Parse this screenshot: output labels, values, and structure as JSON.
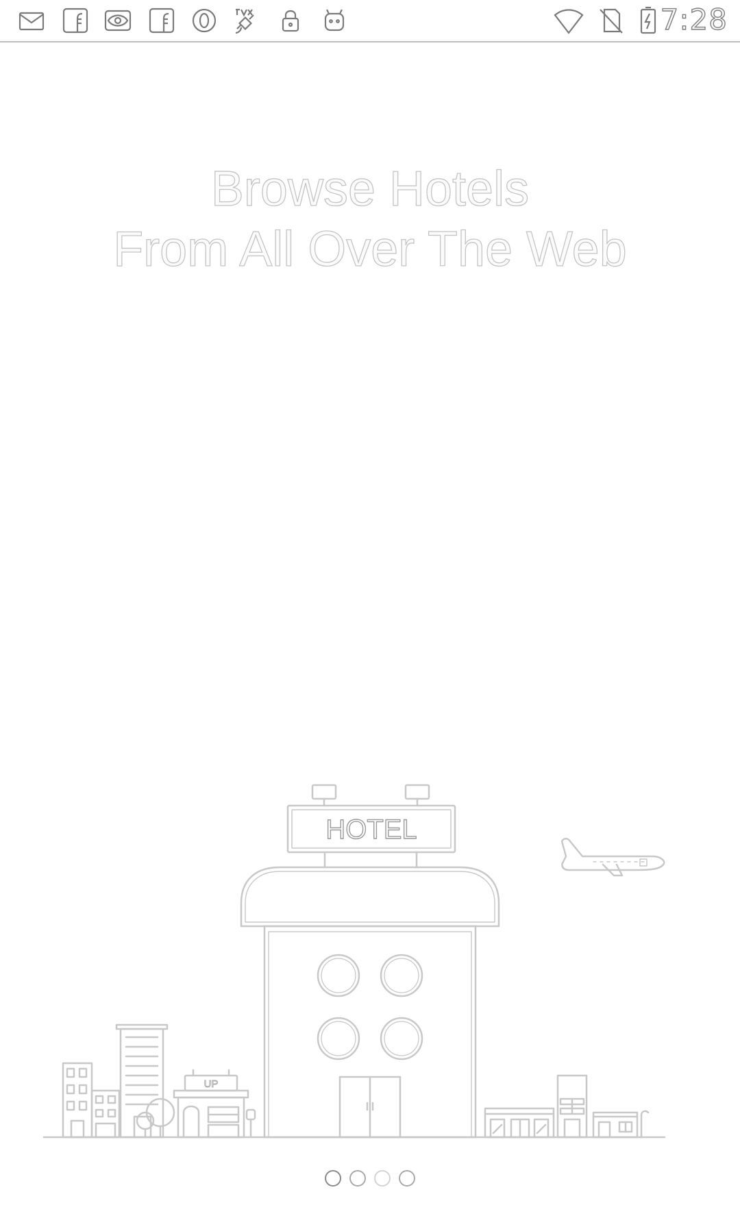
{
  "status_bar": {
    "time": "7:28",
    "left_icons": [
      "email-icon",
      "facebook-icon",
      "eye-icon",
      "facebook-icon",
      "opera-icon",
      "satellite-icon",
      "lock-icon",
      "android-icon"
    ],
    "right_icons": [
      "wifi-icon",
      "no-sim-icon",
      "battery-charging-icon"
    ]
  },
  "onboarding": {
    "headline_line1": "Browse Hotels",
    "headline_line2": "From All Over The Web",
    "hotel_sign": "HOTEL",
    "shop_sign": "UP"
  },
  "pager": {
    "page_count": 4,
    "current_page": 1
  },
  "colors": {
    "background": "#ffffff",
    "line_art": "#c8c8c8",
    "text_outline": "#c4c4c4"
  }
}
